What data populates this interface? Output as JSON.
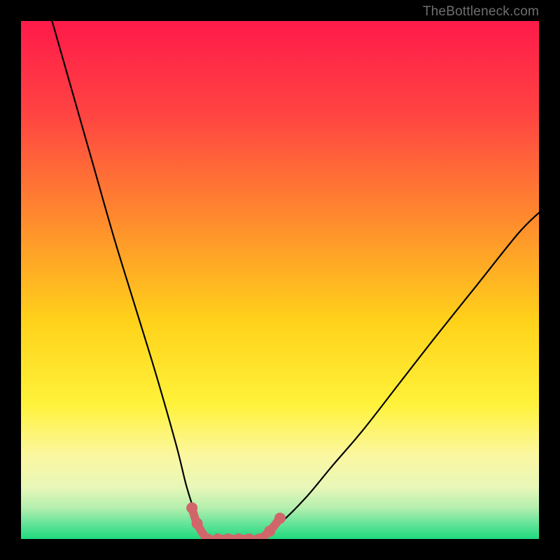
{
  "watermark": "TheBottleneck.com",
  "chart_data": {
    "type": "line",
    "title": "",
    "xlabel": "",
    "ylabel": "",
    "xlim": [
      0,
      100
    ],
    "ylim": [
      0,
      100
    ],
    "grid": false,
    "legend": "none",
    "notes": "Bottleneck-style curve: two black curved branches descending into a flat bottom zone. A salmon-colored overlay marks the optimal (near-zero) segment at the valley floor. No numeric axis ticks are rendered.",
    "series": [
      {
        "name": "left-branch",
        "color": "#000000",
        "x": [
          6,
          10,
          14,
          18,
          22,
          26,
          30,
          32,
          34,
          36
        ],
        "values": [
          100,
          86,
          72,
          58,
          45,
          32,
          18,
          10,
          4,
          0
        ]
      },
      {
        "name": "right-branch",
        "color": "#000000",
        "x": [
          46,
          50,
          55,
          60,
          66,
          73,
          80,
          88,
          96,
          100
        ],
        "values": [
          0,
          3,
          8,
          14,
          21,
          30,
          39,
          49,
          59,
          63
        ]
      },
      {
        "name": "valley-floor",
        "color": "#000000",
        "x": [
          36,
          38,
          40,
          42,
          44,
          46
        ],
        "values": [
          0,
          0,
          0,
          0,
          0,
          0
        ]
      },
      {
        "name": "optimal-band-overlay",
        "color": "#d1666a",
        "x": [
          33,
          34,
          36,
          38,
          40,
          42,
          44,
          46,
          48,
          50
        ],
        "values": [
          6,
          3,
          0,
          0,
          0,
          0,
          0,
          0,
          1.5,
          4
        ]
      }
    ],
    "background_gradient": {
      "stops": [
        {
          "pos": 0.0,
          "color": "#ff1a4a"
        },
        {
          "pos": 0.18,
          "color": "#ff4442"
        },
        {
          "pos": 0.38,
          "color": "#ff8a2e"
        },
        {
          "pos": 0.58,
          "color": "#ffd21a"
        },
        {
          "pos": 0.74,
          "color": "#fff23a"
        },
        {
          "pos": 0.84,
          "color": "#fbf7a2"
        },
        {
          "pos": 0.9,
          "color": "#e8f7b8"
        },
        {
          "pos": 0.94,
          "color": "#b4efae"
        },
        {
          "pos": 0.97,
          "color": "#66e49a"
        },
        {
          "pos": 1.0,
          "color": "#1fd97f"
        }
      ]
    }
  }
}
